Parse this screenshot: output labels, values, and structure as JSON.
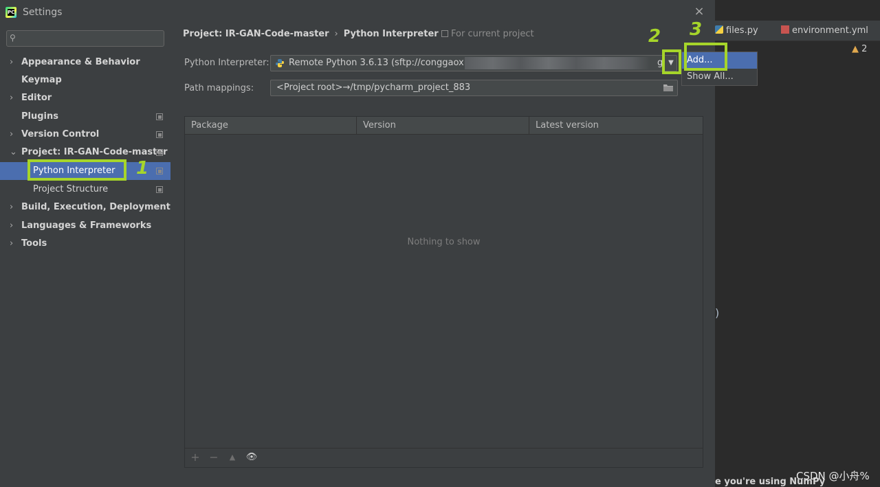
{
  "dialog": {
    "title": "Settings"
  },
  "sidebar": {
    "search_placeholder": "",
    "items": [
      {
        "label": "Appearance & Behavior",
        "expandable": true
      },
      {
        "label": "Keymap",
        "expandable": false
      },
      {
        "label": "Editor",
        "expandable": true
      },
      {
        "label": "Plugins",
        "expandable": false
      },
      {
        "label": "Version Control",
        "expandable": true
      },
      {
        "label": "Project: IR-GAN-Code-master",
        "expandable": true,
        "expanded": true
      },
      {
        "label": "Python Interpreter",
        "selected": true
      },
      {
        "label": "Project Structure"
      },
      {
        "label": "Build, Execution, Deployment",
        "expandable": true
      },
      {
        "label": "Languages & Frameworks",
        "expandable": true
      },
      {
        "label": "Tools",
        "expandable": true
      }
    ]
  },
  "main": {
    "breadcrumb": [
      "Project: IR-GAN-Code-master",
      "Python Interpreter"
    ],
    "for_current_project": "For current project",
    "interpreter_label": "Python Interpreter:",
    "interpreter_value": "Remote Python 3.6.13 (sftp://conggaoxia",
    "interpreter_tail": "g",
    "path_mappings_label": "Path mappings:",
    "path_mappings_value": "<Project root>→/tmp/pycharm_project_883",
    "table": {
      "columns": [
        "Package",
        "Version",
        "Latest version"
      ],
      "empty_text": "Nothing to show"
    },
    "toolbar": {
      "add": "+",
      "remove": "−",
      "upgrade": "▲",
      "show": "👁"
    }
  },
  "popup": {
    "items": [
      "Add...",
      "Show All..."
    ],
    "selected": 0
  },
  "annotations": [
    "1",
    "2",
    "3"
  ],
  "editor": {
    "tabs": [
      "files.py",
      "environment.yml"
    ],
    "warning_count": "2",
    "bracket": ")",
    "bottom_text": "e you're using NumPy"
  },
  "watermark": "CSDN @小舟%",
  "colors": {
    "selection": "#4b6eaf",
    "annotation": "#a6d52a",
    "panel": "#3c3f41",
    "editor_bg": "#2b2b2b"
  }
}
